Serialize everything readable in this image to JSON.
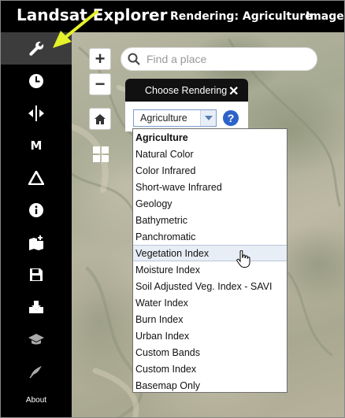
{
  "header": {
    "app_title": "Landsat Explorer",
    "rendering_label": "Rendering: Agriculture",
    "imagery_label": "Imager"
  },
  "sidebar": {
    "items": [
      {
        "icon": "wrench-icon",
        "active": true
      },
      {
        "icon": "clock-icon"
      },
      {
        "icon": "swipe-icon"
      },
      {
        "icon": "m-icon",
        "glyph": "M"
      },
      {
        "icon": "triangle-icon"
      },
      {
        "icon": "info-icon"
      },
      {
        "icon": "add-to-map-icon"
      },
      {
        "icon": "save-icon"
      },
      {
        "icon": "download-icon"
      },
      {
        "icon": "graduation-cap-icon"
      },
      {
        "icon": "story-icon"
      }
    ],
    "about_label": "About"
  },
  "map": {
    "zoom_in": "+",
    "zoom_out": "−",
    "search_placeholder": "Find a place"
  },
  "render_panel": {
    "title": "Choose Rendering",
    "selected_value": "Agriculture",
    "help": "?"
  },
  "dropdown": {
    "options": [
      "Agriculture",
      "Natural Color",
      "Color Infrared",
      "Short-wave Infrared",
      "Geology",
      "Bathymetric",
      "Panchromatic",
      "Vegetation Index",
      "Moisture Index",
      "Soil Adjusted Veg. Index - SAVI",
      "Water Index",
      "Burn Index",
      "Urban Index",
      "Custom Bands",
      "Custom Index",
      "Basemap Only"
    ],
    "selected_index": 0,
    "hover_index": 7
  },
  "colors": {
    "annotation_arrow": "#e6f22a",
    "help_blue": "#2c63c9",
    "sidebar_bg": "#000000",
    "active_item_bg": "#3c3c3c"
  }
}
